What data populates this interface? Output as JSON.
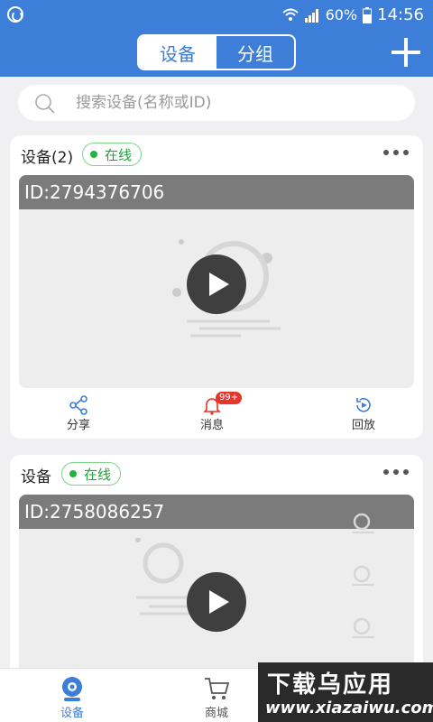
{
  "status_bar": {
    "battery": "60%",
    "time": "14:56"
  },
  "header": {
    "tabs": [
      {
        "label": "设备",
        "active": true
      },
      {
        "label": "分组",
        "active": false
      }
    ],
    "add_icon": "plus-icon"
  },
  "search": {
    "placeholder": "搜索设备(名称或ID)"
  },
  "devices": [
    {
      "title": "设备(2)",
      "status": "在线",
      "id_label": "ID:2794376706",
      "actions": [
        {
          "label": "分享",
          "icon": "share-icon"
        },
        {
          "label": "消息",
          "icon": "bell-icon",
          "badge": "99+"
        },
        {
          "label": "回放",
          "icon": "playback-icon"
        }
      ]
    },
    {
      "title": "设备",
      "status": "在线",
      "id_label": "ID:2758086257"
    }
  ],
  "tab_bar": {
    "items": [
      {
        "label": "设备",
        "active": true,
        "icon": "device-icon"
      },
      {
        "label": "商城",
        "active": false,
        "icon": "cart-icon"
      }
    ]
  },
  "watermark": {
    "title": "下载乌应用",
    "url": "www.xiazaiwu.com"
  },
  "colors": {
    "brand": "#3c7ed8",
    "online": "#23b33f",
    "badge": "#e8342b"
  }
}
